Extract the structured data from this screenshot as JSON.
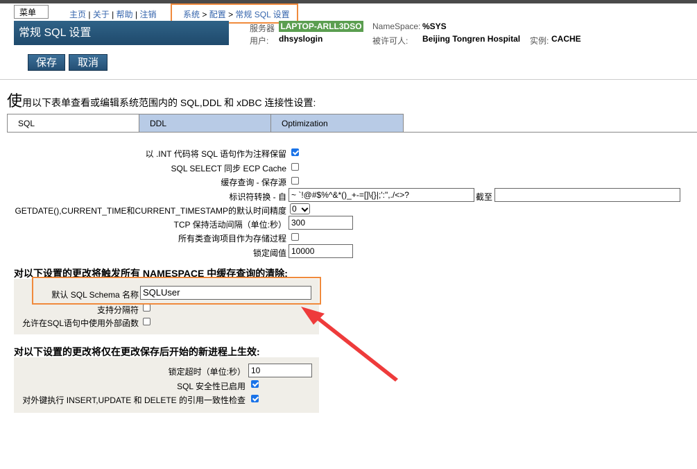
{
  "header": {
    "menu_label": "菜单",
    "links": [
      "主页",
      "关于",
      "帮助",
      "注销"
    ],
    "breadcrumb": [
      "系统",
      "配置",
      "常规 SQL 设置"
    ],
    "page_title": "常规 SQL 设置",
    "server_label": "服务器",
    "server_value": "LAPTOP-ARLL3DSO",
    "namespace_label": "NameSpace:",
    "namespace_value": "%SYS",
    "user_label": "用户:",
    "user_value": "dhsyslogin",
    "licensee_label": "被许可人:",
    "licensee_value": "Beijing Tongren Hospital",
    "instance_label": "实例:",
    "instance_value": "CACHE"
  },
  "toolbar": {
    "save_label": "保存",
    "cancel_label": "取消"
  },
  "intro": {
    "first_char": "使",
    "rest": "用以下表单查看或编辑系统范围内的 SQL,DDL 和 xDBC 连接性设置:"
  },
  "tabs": [
    {
      "label": "SQL",
      "active": true
    },
    {
      "label": "DDL",
      "active": false
    },
    {
      "label": "Optimization",
      "active": false
    }
  ],
  "form": {
    "int_code_label": "以 .INT 代码将 SQL 语句作为注释保留",
    "int_code_checked": true,
    "ecp_label": "SQL SELECT 同步 ECP Cache",
    "ecp_checked": false,
    "cache_query_label": "缓存查询 - 保存源",
    "cache_query_checked": false,
    "identifier_label": "标识符转换 - 自",
    "identifier_from": "~ `!@#$%^&*()_+-=[]\\{}|;':\",./<>?",
    "identifier_to_label": "截至",
    "identifier_to": "",
    "getdate_label": "GETDATE(),CURRENT_TIME和CURRENT_TIMESTAMP的默认时间精度",
    "getdate_value": "0",
    "tcp_label": "TCP 保持活动间隔（单位:秒）",
    "tcp_value": "300",
    "stored_proc_label": "所有类查询项目作为存储过程",
    "stored_proc_checked": false,
    "lock_threshold_label": "锁定阈值",
    "lock_threshold_value": "10000"
  },
  "section1": {
    "heading": "对以下设置的更改将触发所有 NAMESPACE 中缓存查询的清除:",
    "schema_label": "默认 SQL Schema 名称",
    "schema_value": "SQLUser",
    "delimiter_label": "支持分隔符",
    "delimiter_checked": false,
    "external_func_label": "允许在SQL语句中使用外部函数",
    "external_func_checked": false
  },
  "section2": {
    "heading": "对以下设置的更改将仅在更改保存后开始的新进程上生效:",
    "lock_timeout_label": "锁定超时（单位:秒）",
    "lock_timeout_value": "10",
    "security_label": "SQL 安全性已启用",
    "security_checked": true,
    "fk_label": "对外键执行 INSERT,UPDATE 和 DELETE 的引用一致性检查",
    "fk_checked": true
  },
  "colors": {
    "highlight": "#f08a3c",
    "arrow": "#ee3b3b",
    "link": "#3464ac",
    "title_bg": "#2f6287"
  }
}
